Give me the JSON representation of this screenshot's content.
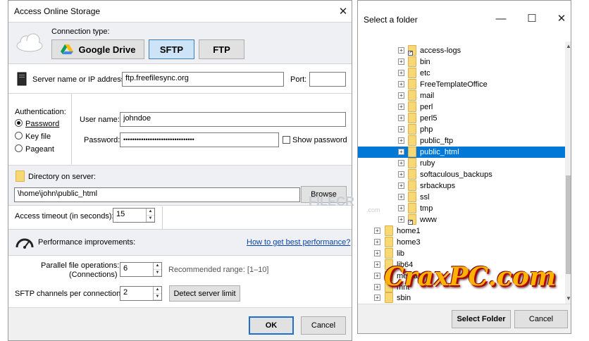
{
  "left_dialog": {
    "title": "Access Online Storage",
    "close": "✕",
    "connection_type_label": "Connection type:",
    "buttons": {
      "google_drive": "Google Drive",
      "sftp": "SFTP",
      "ftp": "FTP"
    },
    "server_label": "Server name or IP address:",
    "server_value": "ftp.freefilesync.org",
    "port_label": "Port:",
    "port_value": "",
    "auth_label": "Authentication:",
    "auth_options": [
      "Password",
      "Key file",
      "Pageant"
    ],
    "username_label": "User name:",
    "username_value": "johndoe",
    "password_label": "Password:",
    "password_value": "••••••••••••••••••••••••••••••••",
    "show_password_label": "Show password",
    "directory_label": "Directory on server:",
    "directory_value": "\\home\\john\\public_html",
    "browse_label": "Browse",
    "timeout_label": "Access timeout (in seconds):",
    "timeout_value": "15",
    "performance_label": "Performance improvements:",
    "performance_link": "How to get best performance?",
    "parallel_label_1": "Parallel file operations:",
    "parallel_label_2": "(Connections)",
    "parallel_value": "6",
    "recommended_label": "Recommended range: [1–10]",
    "channels_label": "SFTP channels per connection:",
    "channels_value": "2",
    "detect_label": "Detect server limit",
    "ok_label": "OK",
    "cancel_label": "Cancel"
  },
  "right_dialog": {
    "title": "Select a folder",
    "minimize": "—",
    "maximize": "☐",
    "close": "✕",
    "tree_sub": [
      "access-logs",
      "bin",
      "etc",
      "FreeTemplateOffice",
      "mail",
      "perl",
      "perl5",
      "php",
      "public_ftp",
      "public_html",
      "ruby",
      "softaculous_backups",
      "srbackups",
      "ssl",
      "tmp",
      "www"
    ],
    "tree_top": [
      "home1",
      "home3",
      "lib",
      "lib64",
      "media",
      "mnt",
      "sbin"
    ],
    "selected_item": "public_html",
    "select_button": "Select Folder",
    "cancel_button": "Cancel"
  },
  "watermarks": {
    "filecr": "FILECR",
    "filecr_sub": ".com",
    "craxpc": "CraxPC.com"
  },
  "colors": {
    "selection": "#0078d7",
    "accent": "#1f6fd0",
    "band": "#eef0f3",
    "link": "#0645ad"
  }
}
